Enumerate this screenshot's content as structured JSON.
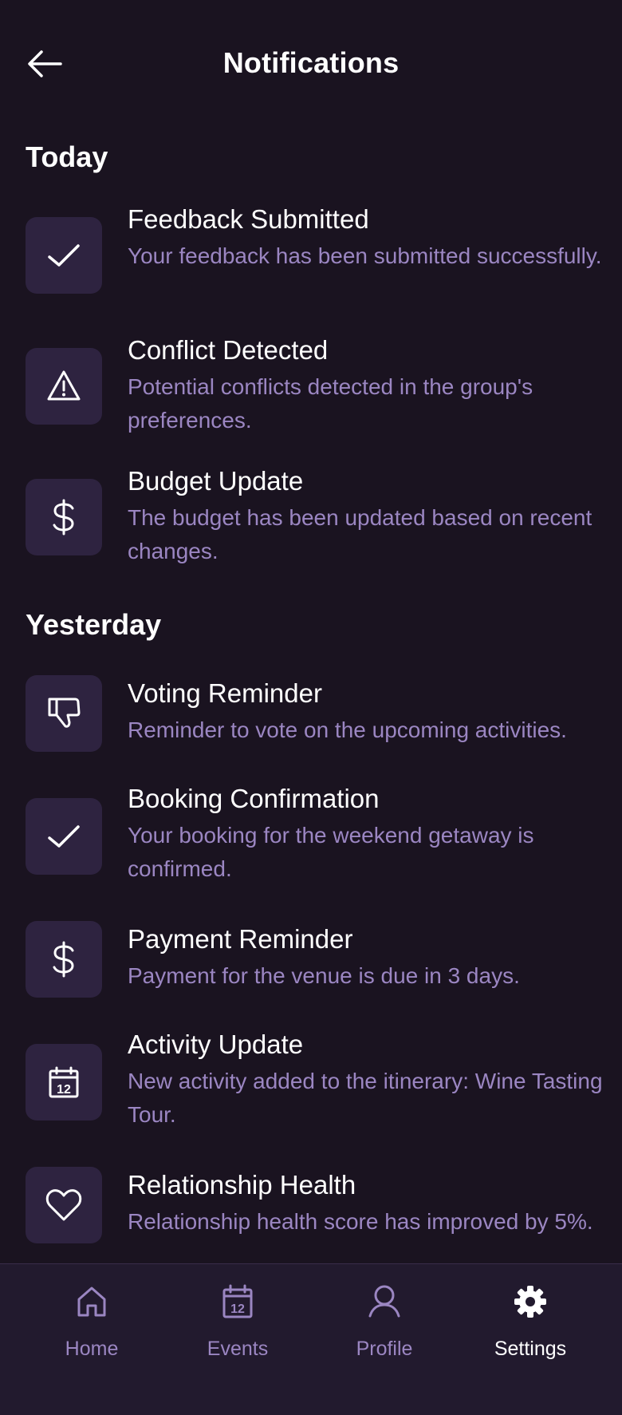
{
  "header": {
    "title": "Notifications",
    "back_icon": "arrow-left-icon"
  },
  "sections": [
    {
      "title": "Today",
      "items": [
        {
          "icon": "check-icon",
          "title": "Feedback Submitted",
          "description": "Your feedback has been submitted successfully."
        },
        {
          "icon": "warning-icon",
          "title": "Conflict Detected",
          "description": "Potential conflicts detected in the group's preferences."
        },
        {
          "icon": "dollar-icon",
          "title": "Budget Update",
          "description": "The budget has been updated based on recent changes."
        }
      ]
    },
    {
      "title": "Yesterday",
      "items": [
        {
          "icon": "thumbs-down-icon",
          "title": "Voting Reminder",
          "description": "Reminder to vote on the upcoming activities."
        },
        {
          "icon": "check-icon",
          "title": "Booking Confirmation",
          "description": "Your booking for the weekend getaway is confirmed."
        },
        {
          "icon": "dollar-icon",
          "title": "Payment Reminder",
          "description": "Payment for the venue is due in 3 days."
        },
        {
          "icon": "calendar-icon",
          "title": "Activity Update",
          "description": "New activity added to the itinerary: Wine Tasting Tour."
        },
        {
          "icon": "heart-icon",
          "title": "Relationship Health",
          "description": "Relationship health score has improved by 5%."
        }
      ]
    }
  ],
  "nav": {
    "items": [
      {
        "label": "Home",
        "icon": "home-icon"
      },
      {
        "label": "Events",
        "icon": "calendar-icon"
      },
      {
        "label": "Profile",
        "icon": "user-icon"
      },
      {
        "label": "Settings",
        "icon": "gear-icon"
      }
    ],
    "active": "Settings"
  },
  "colors": {
    "background": "#1a1320",
    "icon_box": "#2e2340",
    "description": "#9b86c2",
    "nav_background": "#221a2e"
  }
}
